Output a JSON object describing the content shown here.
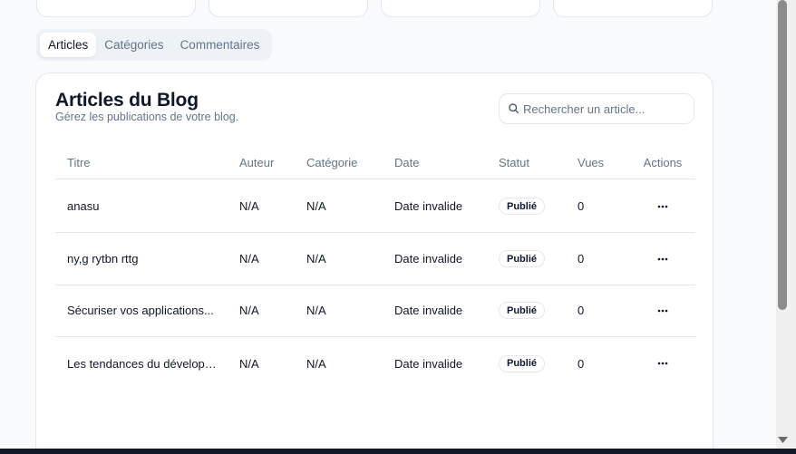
{
  "tabs": [
    {
      "label": "Articles",
      "active": true
    },
    {
      "label": "Catégories",
      "active": false
    },
    {
      "label": "Commentaires",
      "active": false
    }
  ],
  "card": {
    "title": "Articles du Blog",
    "subtitle": "Gérez les publications de votre blog."
  },
  "search": {
    "placeholder": "Rechercher un article...",
    "value": "",
    "icon": "search-icon"
  },
  "table": {
    "columns": [
      "Titre",
      "Auteur",
      "Catégorie",
      "Date",
      "Statut",
      "Vues",
      "Actions"
    ],
    "rows": [
      {
        "title": "anasu",
        "author": "N/A",
        "category": "N/A",
        "date": "Date invalide",
        "status": "Publié",
        "views": "0"
      },
      {
        "title": "ny,g rytbn rttg",
        "author": "N/A",
        "category": "N/A",
        "date": "Date invalide",
        "status": "Publié",
        "views": "0"
      },
      {
        "title": "Sécuriser vos applications...",
        "author": "N/A",
        "category": "N/A",
        "date": "Date invalide",
        "status": "Publié",
        "views": "0"
      },
      {
        "title": "Les tendances du développ...",
        "author": "N/A",
        "category": "N/A",
        "date": "Date invalide",
        "status": "Publié",
        "views": "0"
      }
    ],
    "row_action_icon": "more-horizontal-icon"
  },
  "colors": {
    "page_bg": "#f8fafc",
    "card_bg": "#ffffff",
    "border": "#e2e8f0",
    "text": "#0f172a",
    "muted": "#64748b"
  }
}
